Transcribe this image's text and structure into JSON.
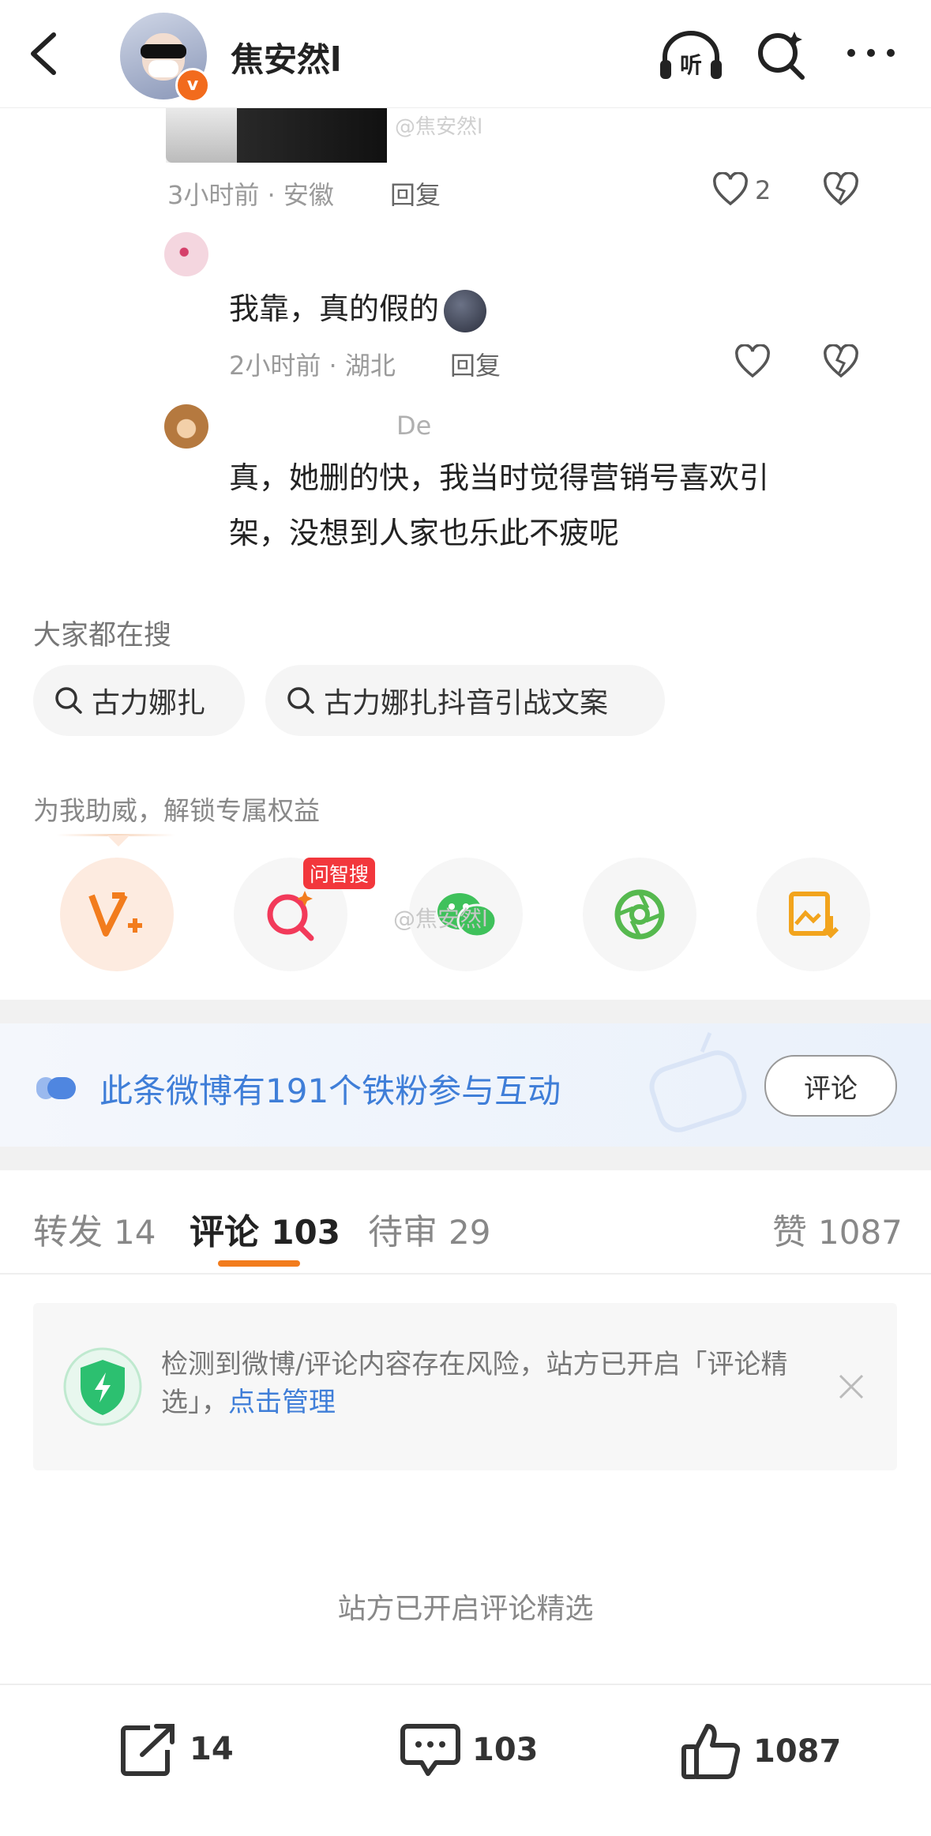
{
  "header": {
    "username": "焦安然l",
    "verified_badge": "v",
    "listen_icon_label": "听"
  },
  "comments": {
    "watermark_top": "@焦安然l",
    "first_meta": {
      "time_location": "3小时前 · 安徽",
      "reply": "回复",
      "likes": "2"
    },
    "second": {
      "text": "我靠，真的假的",
      "time_location": "2小时前 · 湖北",
      "reply": "回复"
    },
    "third": {
      "name_fragment": "De",
      "line1": "真，她删的快，我当时觉得营销号喜欢引",
      "line2": "架，没想到人家也乐此不疲呢"
    }
  },
  "search": {
    "title": "大家都在搜",
    "chips": [
      "古力娜扎",
      "古力娜扎抖音引战文案"
    ]
  },
  "boost": {
    "title": "为我助威，解锁专属权益",
    "badge": "问智搜",
    "watermark": "@焦安然l"
  },
  "fans_banner": {
    "text": "此条微博有191个铁粉参与互动",
    "button": "评论"
  },
  "tabs": {
    "repost": {
      "label": "转发",
      "count": "14"
    },
    "comment": {
      "label": "评论",
      "count": "103"
    },
    "pending": {
      "label": "待审",
      "count": "29"
    },
    "like": {
      "label": "赞",
      "count": "1087"
    }
  },
  "notice": {
    "text": "检测到微博/评论内容存在风险，站方已开启「评论精选」，",
    "link": "点击管理"
  },
  "featured_text": "站方已开启评论精选",
  "bottom_bar": {
    "repost_count": "14",
    "comment_count": "103",
    "like_count": "1087"
  },
  "colors": {
    "accent_orange": "#f27c1d",
    "link_blue": "#3f7ed8",
    "badge_red": "#f2373c",
    "shield_green": "#2cc070"
  }
}
